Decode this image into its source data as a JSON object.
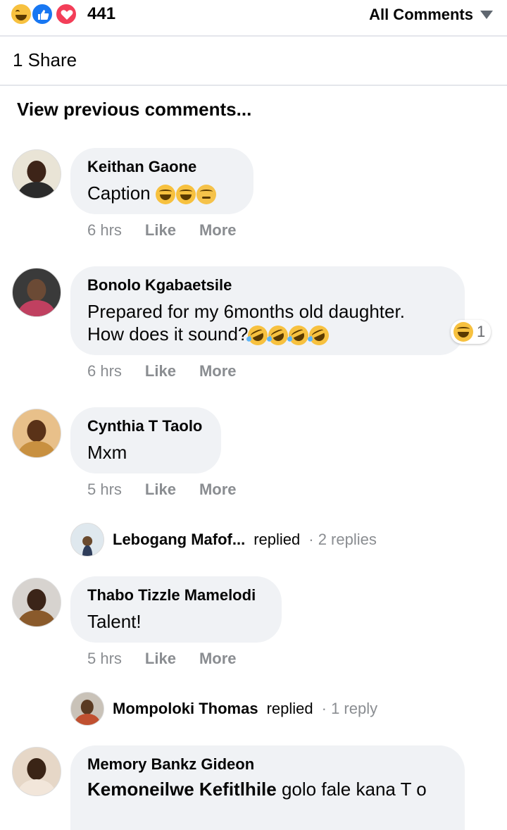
{
  "header": {
    "reaction_count": "441",
    "filter_label": "All Comments",
    "reaction_icons": [
      "haha-icon",
      "like-icon",
      "love-icon"
    ]
  },
  "share_label": "1 Share",
  "view_previous": "View previous comments...",
  "comments": [
    {
      "name": "Keithan Gaone",
      "text": "Caption",
      "emojis": [
        "grin-icon",
        "grin-icon",
        "thinking-icon"
      ],
      "time": "6 hrs",
      "like": "Like",
      "more": "More"
    },
    {
      "name": "Bonolo Kgabaetsile",
      "text_line1": "Prepared for my 6months old daughter.",
      "text_line2": "How does it sound?",
      "emojis": [
        "rofl-icon",
        "rofl-icon",
        "rofl-icon",
        "rofl-icon"
      ],
      "reaction_badge": {
        "icon": "haha-icon",
        "count": "1"
      },
      "time": "6 hrs",
      "like": "Like",
      "more": "More"
    },
    {
      "name": "Cynthia T Taolo",
      "text": "Mxm",
      "time": "5 hrs",
      "like": "Like",
      "more": "More",
      "replies": {
        "name": "Lebogang Mafof...",
        "word": "replied",
        "count": "2 replies"
      }
    },
    {
      "name": "Thabo Tizzle Mamelodi",
      "text": "Talent!",
      "time": "5 hrs",
      "like": "Like",
      "more": "More",
      "replies": {
        "name": "Mompoloki Thomas",
        "word": "replied",
        "count": "1 reply"
      }
    },
    {
      "name": "Memory Bankz Gideon",
      "tagged": "Kemoneilwe Kefitlhile",
      "text": "golo fale kana T o"
    }
  ],
  "colors": {
    "bubble": "#f0f2f5",
    "meta_text": "#8a8d91",
    "divider": "#e4e6eb",
    "like_blue": "#1877f2",
    "love_red": "#f33e58",
    "haha_yellow": "#f7c13f"
  }
}
